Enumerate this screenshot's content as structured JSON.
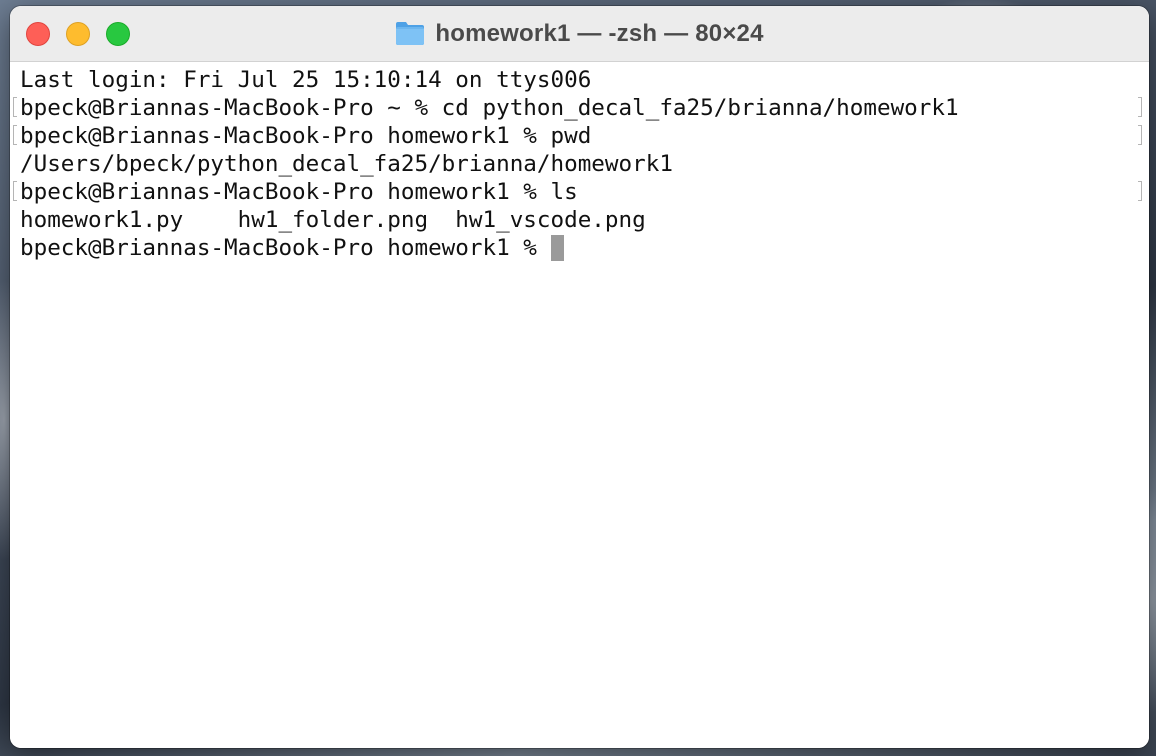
{
  "window": {
    "title": "homework1 — -zsh — 80×24",
    "folder_icon": "folder-icon",
    "buttons": {
      "close": "close-icon",
      "minimize": "minimize-icon",
      "zoom": "zoom-icon"
    },
    "colors": {
      "close": "#fe5f57",
      "minimize": "#febc2e",
      "zoom": "#28c840",
      "cursor": "#9a9a9a"
    }
  },
  "terminal": {
    "lines": [
      "Last login: Fri Jul 25 15:10:14 on ttys006",
      "bpeck@Briannas-MacBook-Pro ~ % cd python_decal_fa25/brianna/homework1",
      "bpeck@Briannas-MacBook-Pro homework1 % pwd",
      "/Users/bpeck/python_decal_fa25/brianna/homework1",
      "bpeck@Briannas-MacBook-Pro homework1 % ls",
      "homework1.py    hw1_folder.png  hw1_vscode.png",
      "bpeck@Briannas-MacBook-Pro homework1 % "
    ]
  }
}
